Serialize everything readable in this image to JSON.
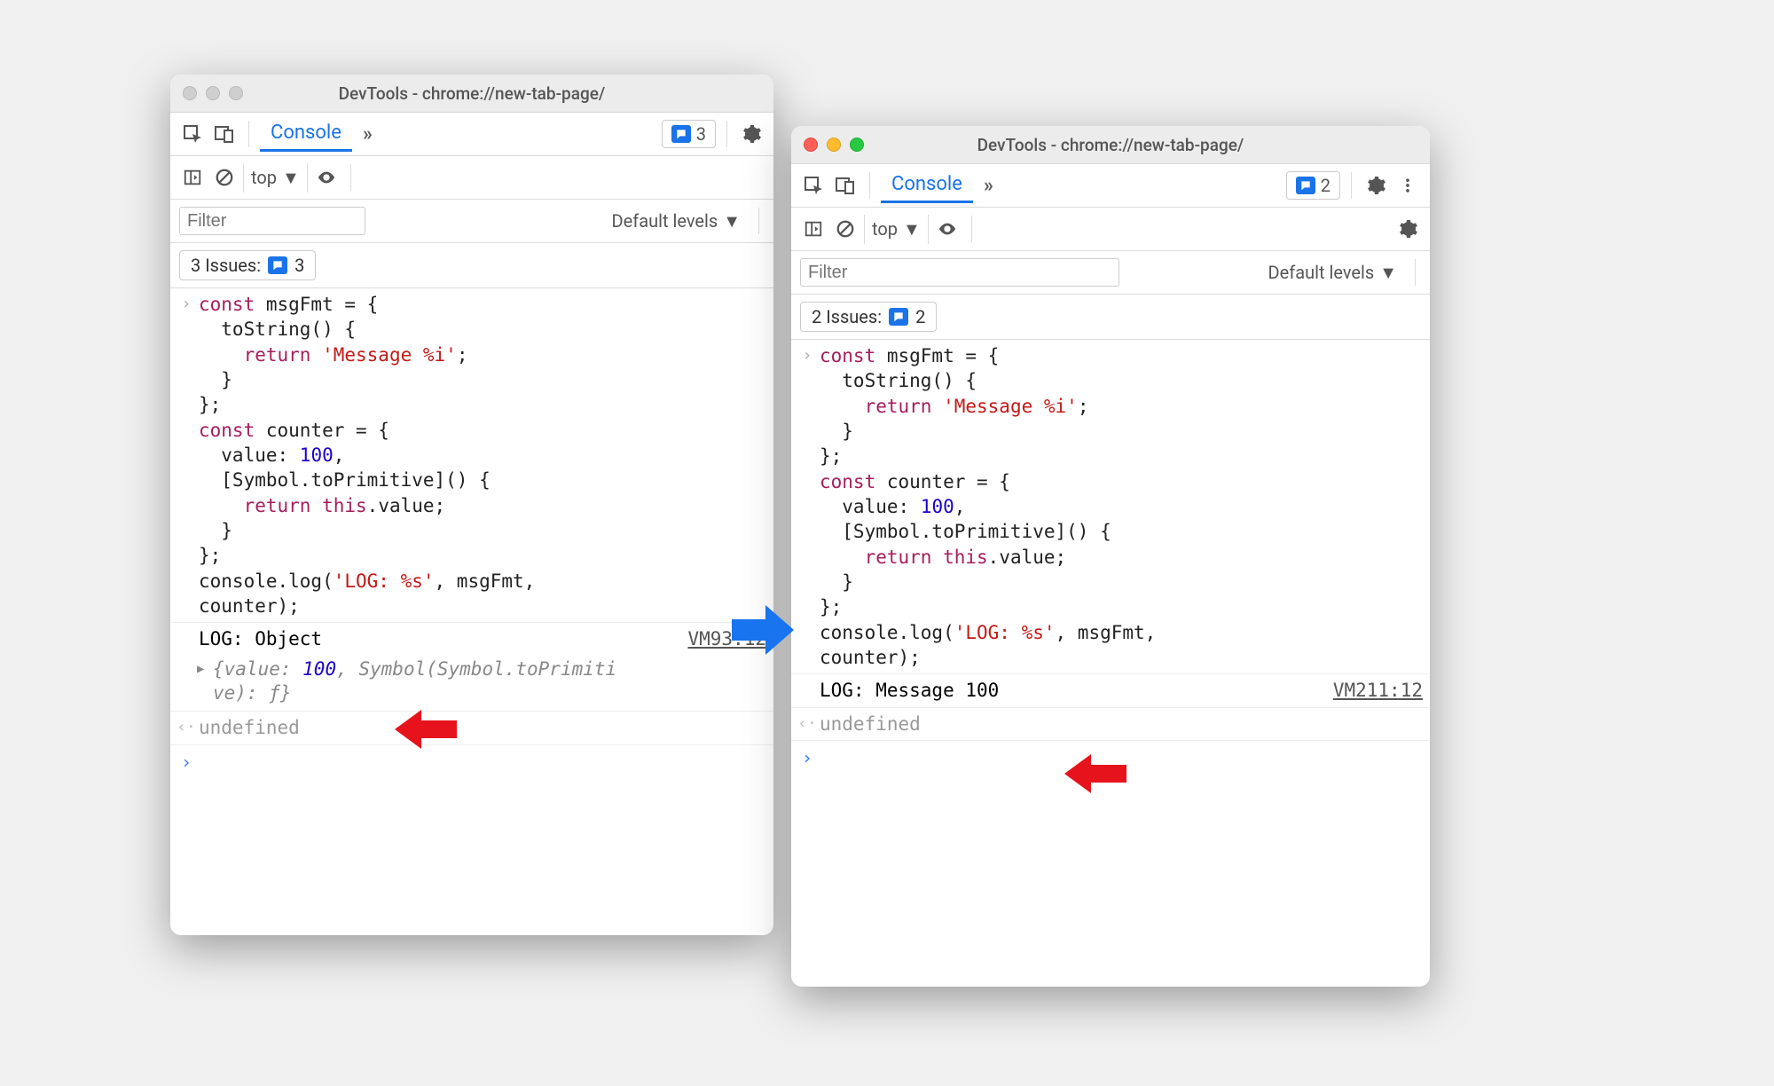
{
  "left": {
    "title": "DevTools - chrome://new-tab-page/",
    "toolbar": {
      "console_tab": "Console",
      "msg_count": "3"
    },
    "context": "top",
    "filter_placeholder": "Filter",
    "levels_label": "Default levels",
    "issues_label": "3 Issues:",
    "issues_count": "3",
    "code_html": "<span class='kw'>const</span> msgFmt = {\n  toString() {\n    <span class='kw'>return</span> <span class='str'>'Message %i'</span>;\n  }\n};\n<span class='kw'>const</span> counter = {\n  value: <span class='num'>100</span>,\n  [Symbol.toPrimitive]() {\n    <span class='kw'>return</span> <span class='kw'>this</span>.value;\n  }\n};\nconsole.log(<span class='str'>'LOG: %s'</span>, msgFmt,\ncounter);",
    "log_text": "LOG: Object",
    "log_source": "VM93:12",
    "obj_preview_html": "{value: <span class='num' style='font-style:italic'>100</span>, Symbol(Symbol.toPrimiti\nve): ƒ}",
    "undefined": "undefined"
  },
  "right": {
    "title": "DevTools - chrome://new-tab-page/",
    "toolbar": {
      "console_tab": "Console",
      "msg_count": "2"
    },
    "context": "top",
    "filter_placeholder": "Filter",
    "levels_label": "Default levels",
    "issues_label": "2 Issues:",
    "issues_count": "2",
    "code_html": "<span class='kw'>const</span> msgFmt = {\n  toString() {\n    <span class='kw'>return</span> <span class='str'>'Message %i'</span>;\n  }\n};\n<span class='kw'>const</span> counter = {\n  value: <span class='num'>100</span>,\n  [Symbol.toPrimitive]() {\n    <span class='kw'>return</span> <span class='kw'>this</span>.value;\n  }\n};\nconsole.log(<span class='str'>'LOG: %s'</span>, msgFmt,\ncounter);",
    "log_text": "LOG: Message 100",
    "log_source": "VM211:12",
    "undefined": "undefined"
  }
}
